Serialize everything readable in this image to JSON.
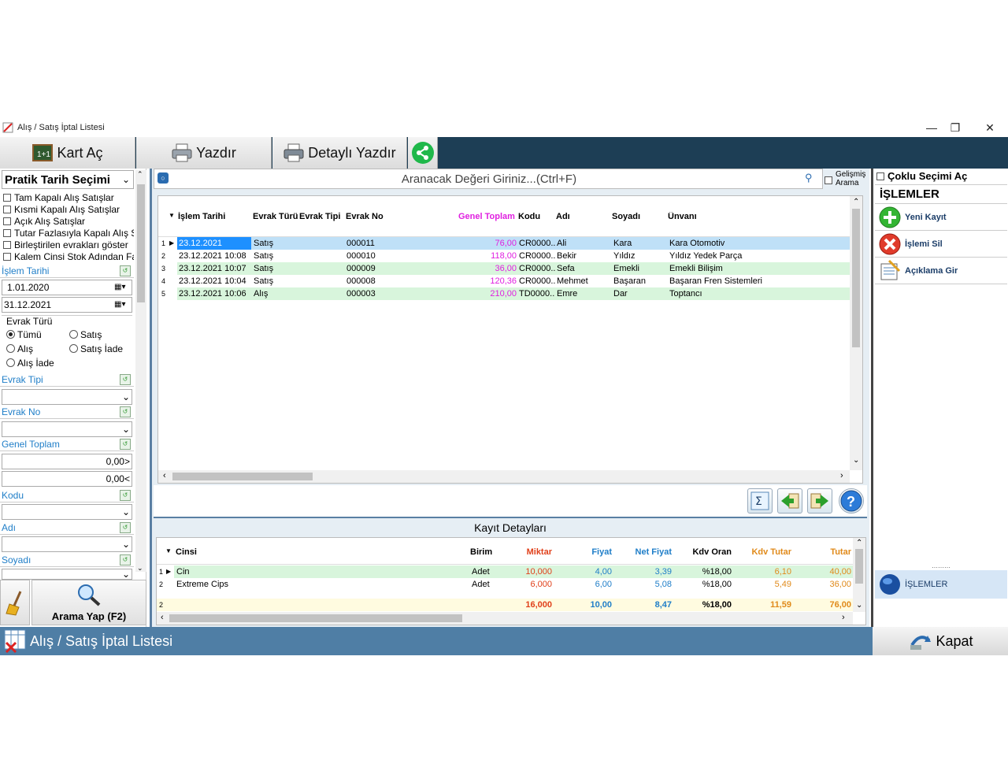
{
  "window": {
    "title": "Alış / Satış İptal Listesi"
  },
  "toolbar": {
    "kart_ac": "Kart Aç",
    "yazdir": "Yazdır",
    "detayli_yazdir": "Detaylı Yazdır"
  },
  "left": {
    "header": "Pratik Tarih Seçimi",
    "options": [
      "Tam Kapalı Alış Satışlar",
      "Kısmi Kapalı Alış Satışlar",
      "Açık Alış Satışlar",
      "Tutar Fazlasıyla Kapalı Alış S",
      "Birleştirilen evrakları göster",
      "Kalem Cinsi Stok Adından Fa"
    ],
    "islem_tarihi_label": "İşlem Tarihi",
    "date_from": "1.01.2020",
    "date_to": "31.12.2021",
    "evrak_turu_label": "Evrak Türü",
    "radios": {
      "tumu": "Tümü",
      "satis": "Satış",
      "alis": "Alış",
      "satis_iade": "Satış İade",
      "alis_iade": "Alış İade"
    },
    "evrak_tipi_label": "Evrak Tipi",
    "evrak_no_label": "Evrak No",
    "genel_toplam_label": "Genel Toplam",
    "gt_min": "0,00>",
    "gt_max": "0,00<",
    "kodu_label": "Kodu",
    "adi_label": "Adı",
    "soyadi_label": "Soyadı",
    "search_button": "Arama Yap (F2)"
  },
  "search": {
    "placeholder": "Aranacak Değeri Giriniz...(Ctrl+F)",
    "gelismis": "Gelişmiş",
    "arama": "Arama"
  },
  "grid": {
    "columns": [
      "İşlem Tarihi",
      "Evrak Türü",
      "Evrak Tipi",
      "Evrak No",
      "Genel Toplam",
      "Kodu",
      "Adı",
      "Soyadı",
      "Ünvanı"
    ],
    "rows": [
      {
        "n": "1",
        "tarih": "23.12.2021",
        "turu": "Satış",
        "tipi": "",
        "no": "000011",
        "toplam": "76,00",
        "kodu": "CR0000...",
        "adi": "Ali",
        "soyadi": "Kara",
        "unvani": "Kara Otomotiv"
      },
      {
        "n": "2",
        "tarih": "23.12.2021 10:08",
        "turu": "Satış",
        "tipi": "",
        "no": "000010",
        "toplam": "118,00",
        "kodu": "CR0000...",
        "adi": "Bekir",
        "soyadi": "Yıldız",
        "unvani": "Yıldız Yedek Parça"
      },
      {
        "n": "3",
        "tarih": "23.12.2021 10:07",
        "turu": "Satış",
        "tipi": "",
        "no": "000009",
        "toplam": "36,00",
        "kodu": "CR0000...",
        "adi": "Sefa",
        "soyadi": "Emekli",
        "unvani": "Emekli Bilişim"
      },
      {
        "n": "4",
        "tarih": "23.12.2021 10:04",
        "turu": "Satış",
        "tipi": "",
        "no": "000008",
        "toplam": "120,36",
        "kodu": "CR0000...",
        "adi": "Mehmet",
        "soyadi": "Başaran",
        "unvani": "Başaran Fren Sistemleri"
      },
      {
        "n": "5",
        "tarih": "23.12.2021 10:06",
        "turu": "Alış",
        "tipi": "",
        "no": "000003",
        "toplam": "210,00",
        "kodu": "TD0000...",
        "adi": "Emre",
        "soyadi": "Dar",
        "unvani": "Toptancı"
      }
    ]
  },
  "details": {
    "title": "Kayıt Detayları",
    "columns": [
      "Cinsi",
      "Birim",
      "Miktar",
      "Fiyat",
      "Net Fiyat",
      "Kdv Oran",
      "Kdv Tutar",
      "Tutar"
    ],
    "rows": [
      {
        "n": "1",
        "cinsi": "Cin",
        "birim": "Adet",
        "miktar": "10,000",
        "fiyat": "4,00",
        "net": "3,39",
        "kdv_oran": "%18,00",
        "kdv_tutar": "6,10",
        "tutar": "40,00"
      },
      {
        "n": "2",
        "cinsi": "Extreme Cips",
        "birim": "Adet",
        "miktar": "6,000",
        "fiyat": "6,00",
        "net": "5,08",
        "kdv_oran": "%18,00",
        "kdv_tutar": "5,49",
        "tutar": "36,00"
      }
    ],
    "footer": {
      "n": "2",
      "miktar": "16,000",
      "fiyat": "10,00",
      "net": "8,47",
      "kdv_oran": "%18,00",
      "kdv_tutar": "11,59",
      "tutar": "76,00"
    }
  },
  "right": {
    "coklu": "Çoklu Seçimi Aç",
    "islemler_header": "İŞLEMLER",
    "yeni_kayit": "Yeni Kayıt",
    "islemi_sil": "İşlemi Sil",
    "aciklama_gir": "Açıklama Gir",
    "islemler_tab": "İŞLEMLER"
  },
  "status": {
    "title": "Alış / Satış İptal Listesi",
    "kapat": "Kapat"
  },
  "colors": {
    "accent": "#1d3e55",
    "status": "#4f7ea5",
    "magenta": "#e020e0",
    "selected": "#bfe0f7",
    "alt_row": "#d8f5dc"
  }
}
